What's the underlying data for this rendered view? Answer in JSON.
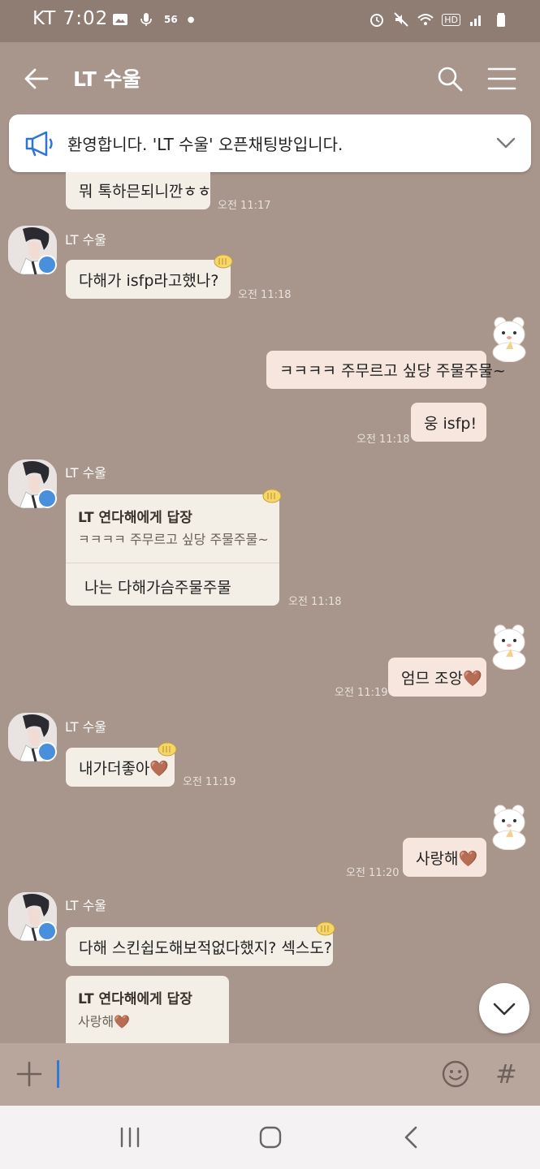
{
  "status_bar": {
    "carrier_time": "KT 7:02",
    "network_label": "56",
    "hd_label": "HD"
  },
  "header": {
    "title": "LT 수울"
  },
  "notice": {
    "text": "환영합니다. 'LT 수울' 오픈채팅방입니다."
  },
  "colors": {
    "background": "#a8958b",
    "my_bubble": "#f6e6dd",
    "their_bubble": "#f3efe6",
    "crown": "#4a8fdc"
  },
  "messages": {
    "m0": {
      "text": "뭐 톡하믄되니깐ㅎㅎ",
      "time": "오전 11:17"
    },
    "m1": {
      "sender": "LT 수울",
      "text": "다해가 isfp라고했나?",
      "time": "오전 11:18"
    },
    "m2": {
      "text": "ㅋㅋㅋㅋ 주무르고 싶당 주물주물~"
    },
    "m3": {
      "text": "웅 isfp!",
      "time": "오전 11:18"
    },
    "m4": {
      "sender": "LT 수울",
      "reply_title": "LT 연다해에게 답장",
      "reply_quote": "ㅋㅋㅋㅋ 주무르고 싶당 주물주물~",
      "text": "나는 다해가슴주물주물",
      "time": "오전 11:18"
    },
    "m5": {
      "text": "엄므 조앙🤎",
      "time": "오전 11:19"
    },
    "m6": {
      "sender": "LT 수울",
      "text": "내가더좋아🤎",
      "time": "오전 11:19"
    },
    "m7": {
      "text": "사랑해🤎",
      "time": "오전 11:20"
    },
    "m8": {
      "sender": "LT 수울",
      "text": "다해 스킨쉽도해보적없다했지? 섹스도?"
    },
    "m9": {
      "reply_title": "LT 연다해에게 답장",
      "reply_quote": "사랑해🤎"
    }
  },
  "input": {
    "value": ""
  },
  "icons": {
    "back": "arrow-left-icon",
    "search": "search-icon",
    "menu": "hamburger-menu-icon",
    "notice": "megaphone-icon",
    "expand": "chevron-down-icon",
    "plus": "plus-icon",
    "emoji": "smiley-icon",
    "hash": "#",
    "scroll": "chevron-down-icon"
  }
}
